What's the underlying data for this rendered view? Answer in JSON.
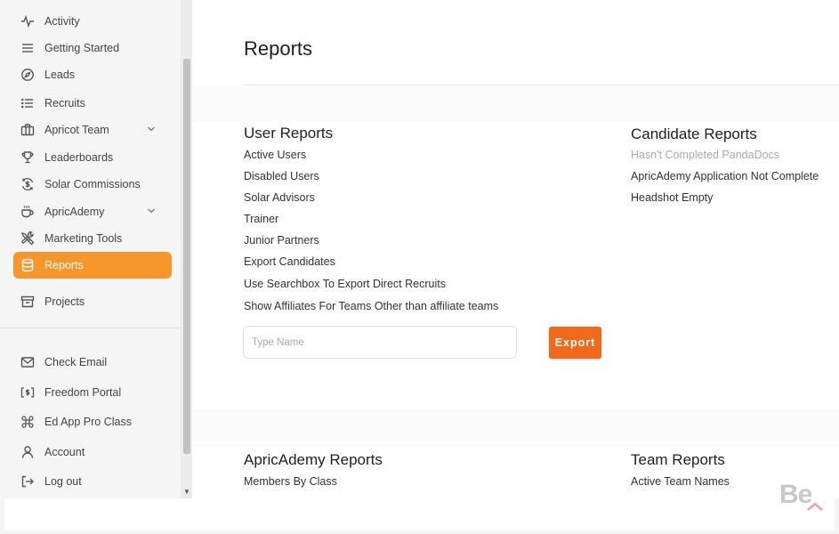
{
  "sidebar": {
    "items": [
      {
        "label": "Activity",
        "icon": "activity-icon"
      },
      {
        "label": "Getting Started",
        "icon": "menu-icon"
      },
      {
        "label": "Leads",
        "icon": "compass-icon"
      },
      {
        "label": "Recruits",
        "icon": "list-icon"
      },
      {
        "label": "Apricot Team",
        "icon": "briefcase-icon"
      },
      {
        "label": "Leaderboards",
        "icon": "trophy-icon"
      },
      {
        "label": "Solar Commissions",
        "icon": "dollar-cycle-icon"
      },
      {
        "label": "ApricAdemy",
        "icon": "coffee-icon"
      },
      {
        "label": "Marketing Tools",
        "icon": "tools-icon"
      },
      {
        "label": "Reports",
        "icon": "database-icon",
        "active": true
      },
      {
        "label": "Projects",
        "icon": "archive-icon"
      }
    ],
    "bottom_items": [
      {
        "label": "Check Email",
        "icon": "mail-icon"
      },
      {
        "label": "Freedom Portal",
        "icon": "portal-icon"
      },
      {
        "label": "Ed App Pro Class",
        "icon": "command-icon"
      },
      {
        "label": "Account",
        "icon": "user-icon"
      },
      {
        "label": "Log out",
        "icon": "logout-icon"
      }
    ]
  },
  "main": {
    "title": "Reports",
    "user_reports": {
      "title": "User Reports",
      "items": [
        "Active Users",
        "Disabled Users",
        "Solar Advisors",
        "Trainer",
        "Junior Partners",
        "Export Candidates",
        "Use Searchbox To Export Direct Recruits",
        "Show Affiliates For Teams Other than affiliate teams"
      ]
    },
    "candidate_reports": {
      "title": "Candidate Reports",
      "items": [
        "Hasn't Completed PandaDocs",
        "ApricAdemy Application Not Complete",
        "Headshot Empty"
      ]
    },
    "export": {
      "placeholder": "Type Name",
      "button_label": "Export"
    },
    "apricademy_reports": {
      "title": "ApricAdemy Reports",
      "items": [
        "Members By Class"
      ]
    },
    "team_reports": {
      "title": "Team Reports",
      "items": [
        "Active Team Names"
      ]
    }
  },
  "colors": {
    "active_nav": "#f7962b",
    "export_button": "#f06a1c"
  },
  "watermark": {
    "text": "Be"
  }
}
